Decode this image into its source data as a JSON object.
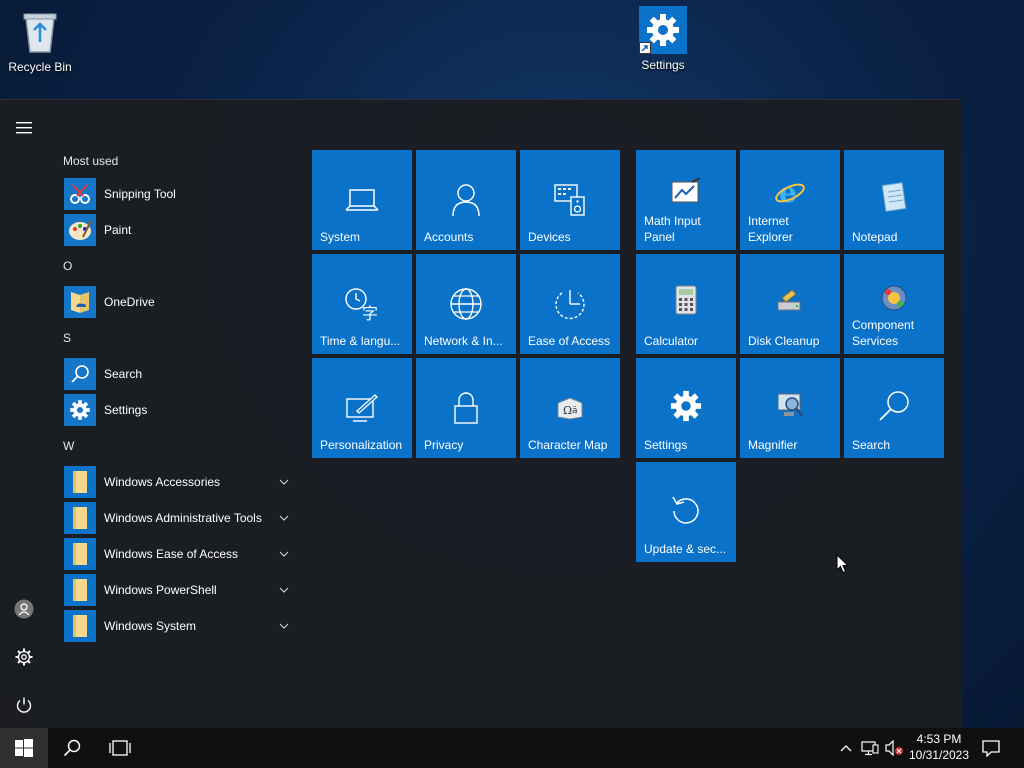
{
  "desktop": {
    "recycle_bin": "Recycle Bin",
    "settings_shortcut": "Settings"
  },
  "start_menu": {
    "sections": {
      "most_used": "Most used",
      "o": "O",
      "s": "S",
      "w": "W"
    },
    "apps": {
      "snipping_tool": "Snipping Tool",
      "paint": "Paint",
      "onedrive": "OneDrive",
      "search": "Search",
      "settings": "Settings",
      "win_accessories": "Windows Accessories",
      "win_admin_tools": "Windows Administrative Tools",
      "win_ease": "Windows Ease of Access",
      "win_powershell": "Windows PowerShell",
      "win_system": "Windows System"
    },
    "tiles": {
      "system": "System",
      "accounts": "Accounts",
      "devices": "Devices",
      "time_language": "Time & langu...",
      "network": "Network & In...",
      "ease_of_access": "Ease of Access",
      "personalization": "Personalization",
      "privacy": "Privacy",
      "character_map": "Character Map",
      "math_input": "Math Input Panel",
      "internet_explorer": "Internet Explorer",
      "notepad": "Notepad",
      "calculator": "Calculator",
      "disk_cleanup": "Disk Cleanup",
      "component_services": "Component Services",
      "settings": "Settings",
      "magnifier": "Magnifier",
      "search": "Search",
      "update_security": "Update & sec..."
    }
  },
  "taskbar": {
    "time": "4:53 PM",
    "date": "10/31/2023"
  },
  "colors": {
    "tile_blue": "#0a72c8",
    "taskbar": "#101010",
    "menu_bg": "#1b1d21"
  }
}
